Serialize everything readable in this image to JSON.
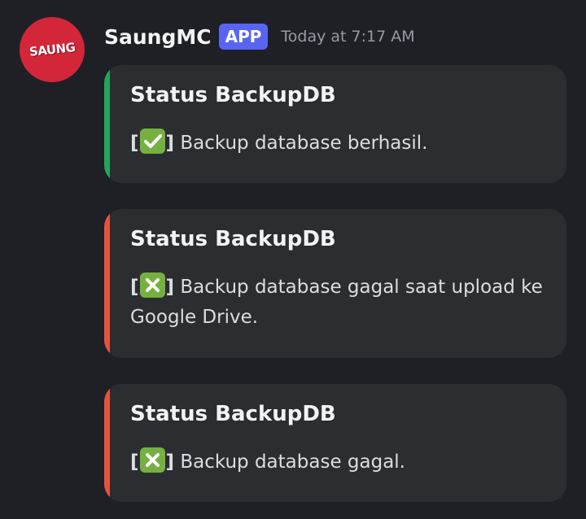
{
  "message": {
    "avatar_text": "SAUNG",
    "username": "SaungMC",
    "badge": "APP",
    "timestamp": "Today at 7:17 AM"
  },
  "embeds": [
    {
      "title": "Status BackupDB",
      "bracket_open": "[",
      "bracket_close": "]",
      "icon": "check-mark-button-icon",
      "text": "Backup database berhasil.",
      "accent_color": "#23a55a"
    },
    {
      "title": "Status BackupDB",
      "bracket_open": "[",
      "bracket_close": "]",
      "icon": "cross-mark-button-icon",
      "text": "Backup database gagal saat upload ke Google Drive.",
      "accent_color": "#e5533d"
    },
    {
      "title": "Status BackupDB",
      "bracket_open": "[",
      "bracket_close": "]",
      "icon": "cross-mark-button-icon",
      "text": "Backup database gagal.",
      "accent_color": "#e5533d"
    }
  ],
  "colors": {
    "background": "#1f2025",
    "embed_background": "#2b2d31",
    "app_badge": "#5865f2",
    "avatar": "#d32639"
  }
}
